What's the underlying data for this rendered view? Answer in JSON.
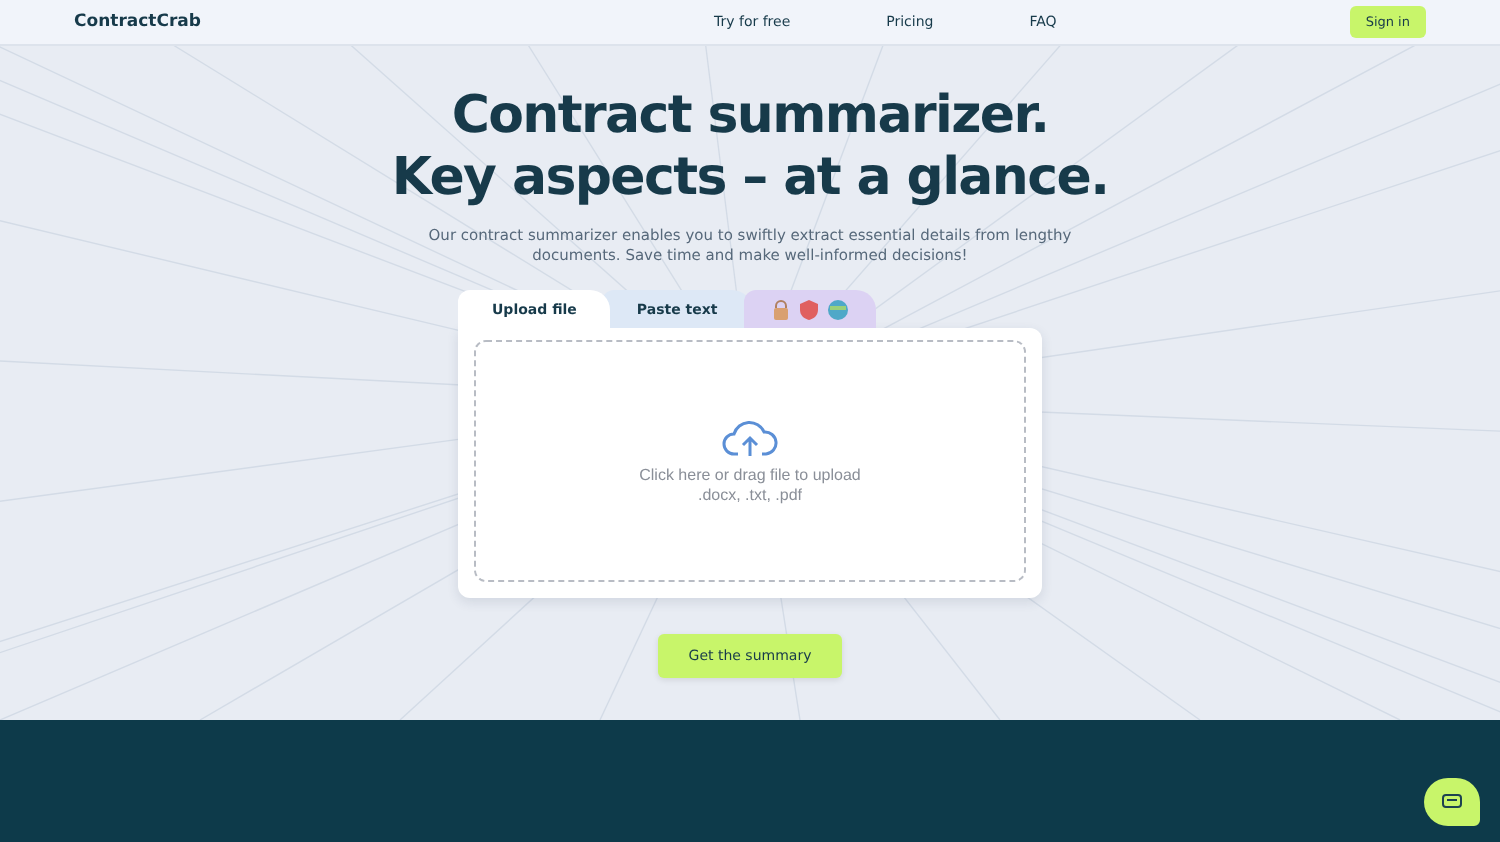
{
  "header": {
    "logo": "ContractCrab",
    "nav": [
      "Try for free",
      "Pricing",
      "FAQ"
    ],
    "sign_in": "Sign in"
  },
  "hero": {
    "title_lines": [
      "Contract summarizer.",
      "Key aspects – at a glance."
    ],
    "subtitle": "Our contract summarizer enables you to swiftly extract essential details from lengthy documents. Save time and make well-informed decisions!"
  },
  "tabs": [
    {
      "kind": "text",
      "label": "Upload file",
      "selected": true
    },
    {
      "kind": "text",
      "label": "Paste text",
      "selected": false
    },
    {
      "kind": "icons",
      "selected": false
    }
  ],
  "dropzone": {
    "prompt": "Click here or drag file to upload",
    "formats": ".docx, .txt, .pdf"
  },
  "submit": "Get the summary"
}
